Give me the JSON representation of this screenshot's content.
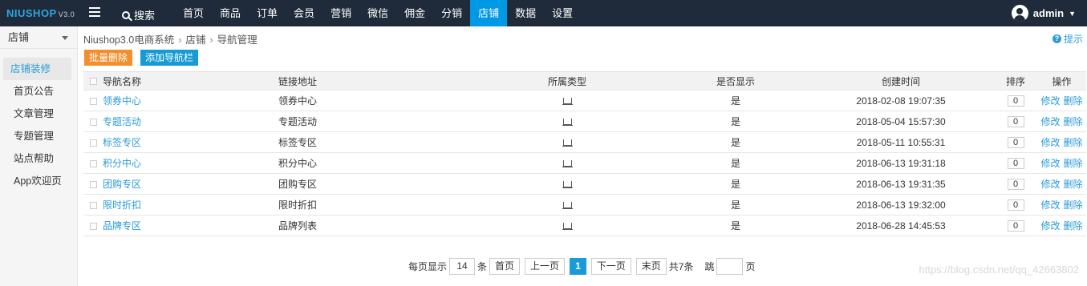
{
  "topbar": {
    "logo_main": "NIUSHOP",
    "logo_version": "V3.0",
    "search_label": "搜索",
    "nav": [
      "首页",
      "商品",
      "订单",
      "会员",
      "营销",
      "微信",
      "佣金",
      "分销",
      "店铺",
      "数据",
      "设置"
    ],
    "active_nav": "店铺",
    "user": "admin"
  },
  "sidebar": {
    "title": "店铺",
    "items": [
      "店铺装修",
      "首页公告",
      "文章管理",
      "专题管理",
      "站点帮助",
      "App欢迎页"
    ],
    "active_item": "店铺装修"
  },
  "breadcrumb": [
    "Niushop3.0电商系统",
    "店铺",
    "导航管理"
  ],
  "hint": "提示",
  "buttons": {
    "batch_delete": "批量删除",
    "add_nav": "添加导航栏"
  },
  "table": {
    "headers": [
      "导航名称",
      "链接地址",
      "所属类型",
      "是否显示",
      "创建时间",
      "排序",
      "操作"
    ],
    "rows": [
      {
        "name": "领券中心",
        "link": "领券中心",
        "shown": "是",
        "created": "2018-02-08 19:07:35",
        "sort": "0"
      },
      {
        "name": "专题活动",
        "link": "专题活动",
        "shown": "是",
        "created": "2018-05-04 15:57:30",
        "sort": "0"
      },
      {
        "name": "标签专区",
        "link": "标签专区",
        "shown": "是",
        "created": "2018-05-11 10:55:31",
        "sort": "0"
      },
      {
        "name": "积分中心",
        "link": "积分中心",
        "shown": "是",
        "created": "2018-06-13 19:31:18",
        "sort": "0"
      },
      {
        "name": "团购专区",
        "link": "团购专区",
        "shown": "是",
        "created": "2018-06-13 19:31:35",
        "sort": "0"
      },
      {
        "name": "限时折扣",
        "link": "限时折扣",
        "shown": "是",
        "created": "2018-06-13 19:32:00",
        "sort": "0"
      },
      {
        "name": "品牌专区",
        "link": "品牌列表",
        "shown": "是",
        "created": "2018-06-28 14:45:53",
        "sort": "0"
      }
    ],
    "type_icon": "desktop-icon",
    "edit_label": "修改",
    "delete_label": "删除"
  },
  "pager": {
    "per_page_prefix": "每页显示",
    "per_page_value": "14",
    "per_page_suffix": "条",
    "first": "首页",
    "prev": "上一页",
    "current": "1",
    "next": "下一页",
    "last": "末页",
    "total": "共7条",
    "jump_prefix": "跳",
    "jump_suffix": "页"
  },
  "watermark": "https://blog.csdn.net/qq_42663802",
  "colors": {
    "topbar": "#1f2a3a",
    "accent": "#0099e5",
    "orange": "#f28e2b",
    "link": "#2b9bd8"
  }
}
